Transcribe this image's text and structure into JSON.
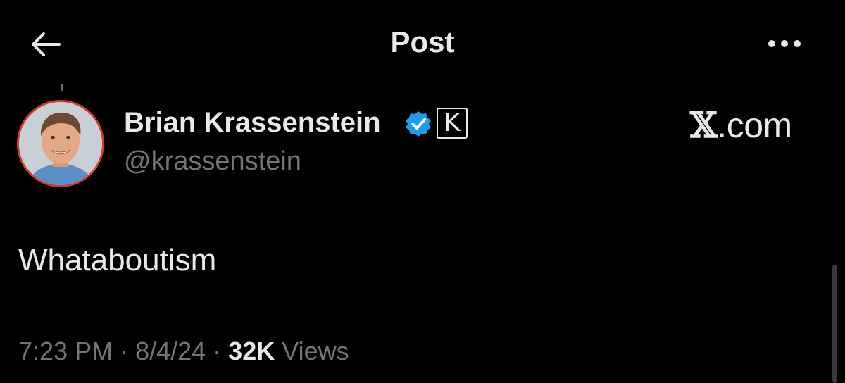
{
  "header": {
    "title": "Post",
    "back_icon": "arrow-left-icon",
    "more_icon": "ellipsis-horizontal-icon"
  },
  "author": {
    "name": "Brian Krassenstein",
    "handle": "@krassenstein",
    "verified_icon": "verified-badge-icon",
    "affiliate_badge": "K",
    "ring_color": "#d63b2a",
    "verified_color": "#1d9bf0"
  },
  "brand": {
    "x_glyph": "𝕏",
    "domain_text": ".com"
  },
  "tweet": {
    "text": "Whataboutism"
  },
  "meta": {
    "time": "7:23 PM",
    "sep1": " · ",
    "date": "8/4/24",
    "sep2": " · ",
    "views_count": "32K",
    "views_label": " Views"
  },
  "colors": {
    "background": "#000000",
    "primary_text": "#e7e9ea",
    "secondary_text": "#71767b"
  }
}
